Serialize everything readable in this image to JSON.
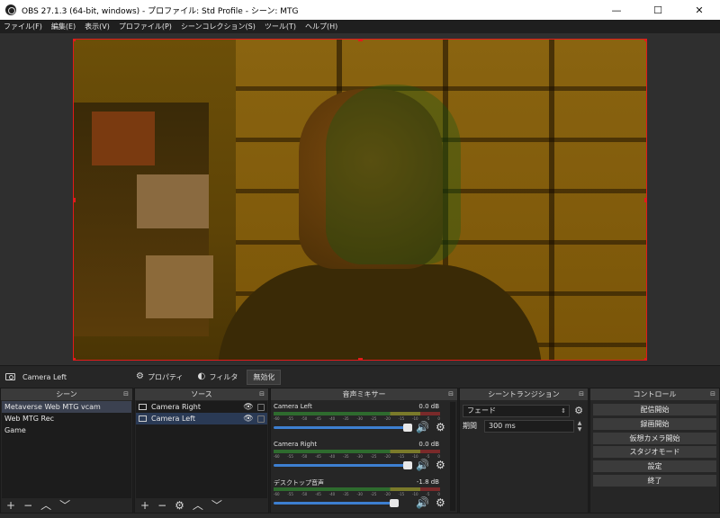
{
  "window": {
    "title": "OBS 27.1.3 (64-bit, windows) - プロファイル: Std Profile - シーン: MTG",
    "minimize": "—",
    "maximize": "☐",
    "close": "✕"
  },
  "menu": [
    "ファイル(F)",
    "編集(E)",
    "表示(V)",
    "プロファイル(P)",
    "シーンコレクション(S)",
    "ツール(T)",
    "ヘルプ(H)"
  ],
  "source_bar": {
    "selected_source": "Camera Left",
    "properties": "プロパティ",
    "filters": "フィルタ",
    "disable": "無効化"
  },
  "scenes": {
    "header": "シーン",
    "items": [
      "Metaverse Web MTG vcam",
      "Web MTG Rec",
      "Game"
    ],
    "selected_index": 0
  },
  "sources": {
    "header": "ソース",
    "items": [
      {
        "label": "Camera Right",
        "visible": true,
        "selected": false
      },
      {
        "label": "Camera Left",
        "visible": true,
        "selected": true
      }
    ]
  },
  "mixer": {
    "header": "音声ミキサー",
    "ticks": [
      "-60",
      "-55",
      "-50",
      "-45",
      "-40",
      "-35",
      "-30",
      "-25",
      "-20",
      "-15",
      "-10",
      "-5",
      "0"
    ],
    "channels": [
      {
        "name": "Camera Left",
        "db": "0.0 dB",
        "volume": 0.8
      },
      {
        "name": "Camera Right",
        "db": "0.0 dB",
        "volume": 0.8
      },
      {
        "name": "デスクトップ音声",
        "db": "-1.8 dB",
        "volume": 0.7
      }
    ]
  },
  "transitions": {
    "header": "シーントランジション",
    "selected": "フェード",
    "duration_label": "期間",
    "duration_value": "300 ms"
  },
  "controls": {
    "header": "コントロール",
    "buttons": [
      "配信開始",
      "録画開始",
      "仮想カメラ開始",
      "スタジオモード",
      "設定",
      "終了"
    ]
  },
  "colors": {
    "selection_border": "#e01b1b",
    "accent": "#3d7fd0"
  }
}
